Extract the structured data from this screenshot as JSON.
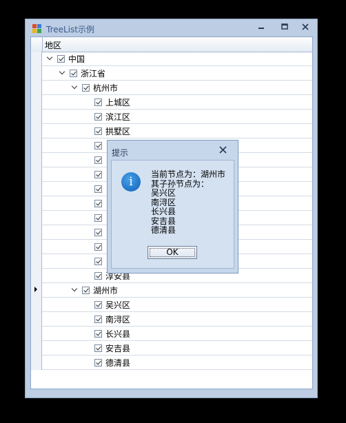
{
  "window": {
    "title": "TreeList示例",
    "min": "▭",
    "max": "▣",
    "close": "✕"
  },
  "tree": {
    "header": "地区",
    "rows": [
      {
        "level": 0,
        "expander": true,
        "label": "中国"
      },
      {
        "level": 1,
        "expander": true,
        "label": "浙江省"
      },
      {
        "level": 2,
        "expander": true,
        "label": "杭州市"
      },
      {
        "level": 3,
        "expander": false,
        "label": "上城区"
      },
      {
        "level": 3,
        "expander": false,
        "label": "滨江区"
      },
      {
        "level": 3,
        "expander": false,
        "label": "拱墅区"
      },
      {
        "level": 3,
        "expander": false,
        "label": ""
      },
      {
        "level": 3,
        "expander": false,
        "label": ""
      },
      {
        "level": 3,
        "expander": false,
        "label": ""
      },
      {
        "level": 3,
        "expander": false,
        "label": ""
      },
      {
        "level": 3,
        "expander": false,
        "label": ""
      },
      {
        "level": 3,
        "expander": false,
        "label": ""
      },
      {
        "level": 3,
        "expander": false,
        "label": ""
      },
      {
        "level": 3,
        "expander": false,
        "label": ""
      },
      {
        "level": 3,
        "expander": false,
        "label": ""
      },
      {
        "level": 3,
        "expander": false,
        "label": "淳安县"
      },
      {
        "level": 2,
        "expander": true,
        "label": "湖州市",
        "focused": true
      },
      {
        "level": 3,
        "expander": false,
        "label": "吴兴区"
      },
      {
        "level": 3,
        "expander": false,
        "label": "南浔区"
      },
      {
        "level": 3,
        "expander": false,
        "label": "长兴县"
      },
      {
        "level": 3,
        "expander": false,
        "label": "安吉县"
      },
      {
        "level": 3,
        "expander": false,
        "label": "德清县"
      }
    ]
  },
  "dialog": {
    "title": "提示",
    "close": "⛝",
    "icon": "i",
    "lines": [
      "当前节点为：湖州市",
      "其子孙节点为：",
      "吴兴区",
      "南浔区",
      "长兴县",
      "安吉县",
      "德清县"
    ],
    "ok": "OK"
  },
  "colors": {
    "window_bg": "#bccde4",
    "dialog_bg": "#c6d7ec",
    "info_blue": "#0d5fb8"
  }
}
